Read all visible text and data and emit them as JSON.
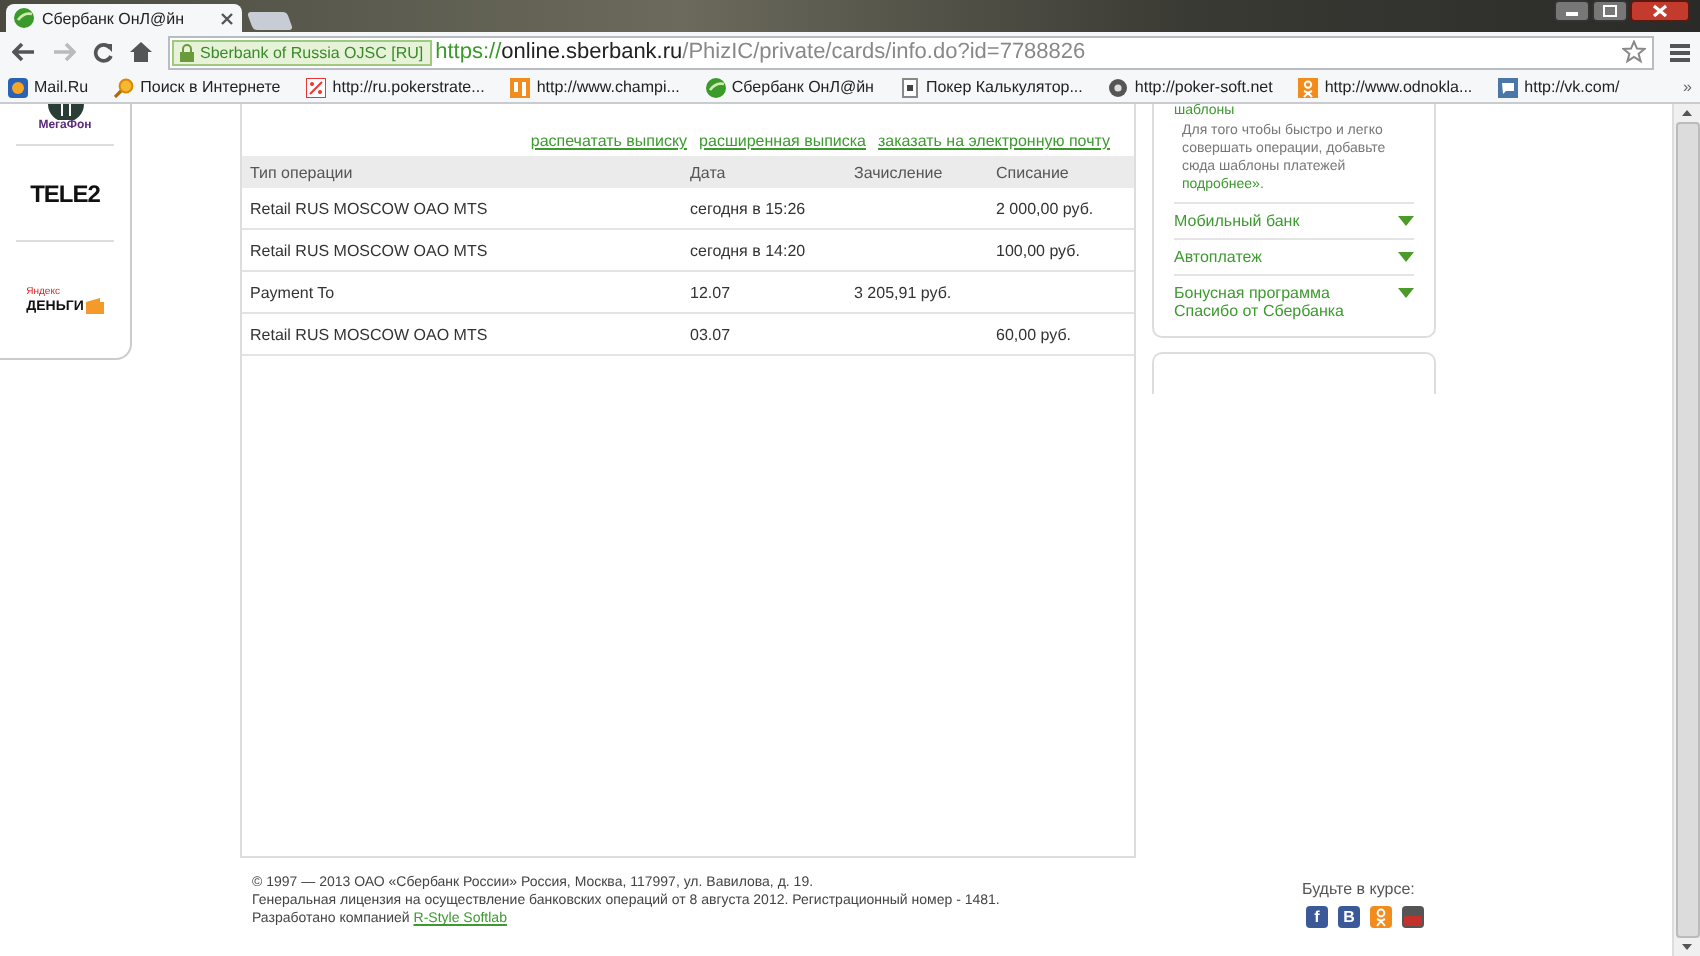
{
  "browser": {
    "tab": {
      "title": "Сбербанк ОнЛ@йн",
      "selected": true
    },
    "address": {
      "identity": "Sberbank of Russia OJSC [RU]",
      "scheme": "https://",
      "host": "online.sberbank.ru",
      "path": "/PhizIC/private/cards/info.do?id=7788826"
    },
    "bookmarks": [
      {
        "kind": "mail",
        "label": "Mail.Ru"
      },
      {
        "kind": "search",
        "label": "Поиск в Интернете"
      },
      {
        "kind": "percent",
        "label": "http://ru.pokerstrate..."
      },
      {
        "kind": "orange",
        "label": "http://www.champi..."
      },
      {
        "kind": "sber",
        "label": "Сбербанк ОнЛ@йн"
      },
      {
        "kind": "page",
        "label": "Покер Калькулятор..."
      },
      {
        "kind": "gear",
        "label": "http://poker-soft.net"
      },
      {
        "kind": "ok",
        "label": "http://www.odnokla..."
      },
      {
        "kind": "chat",
        "label": "http://vk.com/"
      }
    ],
    "more": "»"
  },
  "sidebar": {
    "logos": [
      {
        "kind": "megafon",
        "label": "МегаФон"
      },
      {
        "kind": "tele2",
        "label": "TELE2"
      },
      {
        "kind": "yandex",
        "top": "Яндекс",
        "label": "ДЕНЬГИ"
      }
    ]
  },
  "statement": {
    "links": [
      "распечатать выписку",
      "расширенная выписка",
      "заказать на электронную почту"
    ],
    "columns": [
      "Тип операции",
      "Дата",
      "Зачисление",
      "Списание"
    ],
    "rows": [
      [
        "Retail RUS MOSCOW OAO MTS",
        "сегодня в 15:26",
        "",
        "2 000,00 руб."
      ],
      [
        "Retail RUS MOSCOW OAO MTS",
        "сегодня в 14:20",
        "",
        "100,00 руб."
      ],
      [
        "Payment To",
        "12.07",
        "3 205,91 руб.",
        ""
      ],
      [
        "Retail RUS MOSCOW OAO MTS",
        "03.07",
        "",
        "60,00 руб."
      ]
    ]
  },
  "right_panel": {
    "heading": "шаблоны",
    "text": "Для того чтобы быстро и легко совершать операции, добавьте сюда шаблоны платежей",
    "more_link": "подробнее»",
    "more_after": ".",
    "items": [
      {
        "label": "Мобильный банк",
        "expanded": false
      },
      {
        "label": "Автоплатеж",
        "expanded": false
      },
      {
        "label": "Бонусная программа Спасибо от Сбербанка",
        "expanded": false
      }
    ]
  },
  "footer": {
    "lines": [
      "© 1997 — 2013 ОАО «Сбербанк России» Россия, Москва, 117997, ул. Вавилова, д. 19.",
      "Генеральная лицензия на осуществление банковских операций от 8 августа 2012. Регистрационный номер - 1481."
    ],
    "developer": "Разработано компанией",
    "developer_link": "R-Style Softlab",
    "social_title": "Будьте в курсе:",
    "social": [
      {
        "kind": "facebook",
        "glyph": "f"
      },
      {
        "kind": "vk",
        "glyph": "B"
      },
      {
        "kind": "ok"
      },
      {
        "kind": "youtube"
      }
    ]
  }
}
